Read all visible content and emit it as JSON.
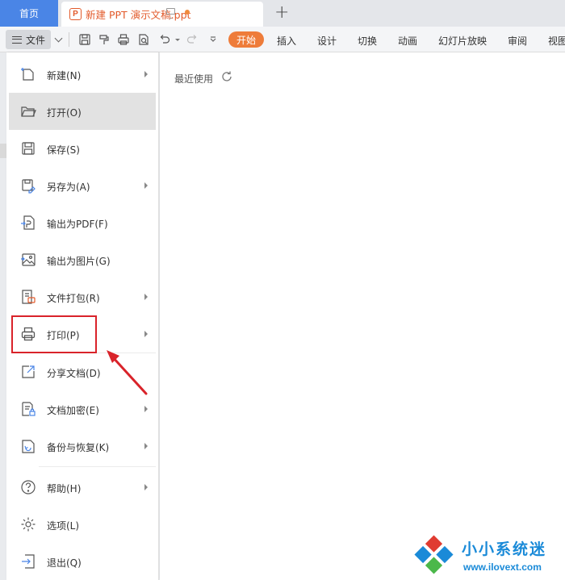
{
  "tabs": {
    "home": "首页",
    "document": "新建 PPT 演示文稿.ppt",
    "add": "+"
  },
  "toolbar": {
    "file_label": "文件",
    "start": "开始",
    "tabs": [
      "插入",
      "设计",
      "切换",
      "动画",
      "幻灯片放映",
      "审阅",
      "视图"
    ]
  },
  "menu": {
    "items": [
      {
        "label": "新建(N)",
        "icon": "new-document-icon",
        "submenu": true
      },
      {
        "label": "打开(O)",
        "icon": "folder-open-icon",
        "submenu": false,
        "active": true
      },
      {
        "label": "保存(S)",
        "icon": "save-icon",
        "submenu": false
      },
      {
        "label": "另存为(A)",
        "icon": "save-as-icon",
        "submenu": true
      },
      {
        "label": "输出为PDF(F)",
        "icon": "export-pdf-icon",
        "submenu": false
      },
      {
        "label": "输出为图片(G)",
        "icon": "export-image-icon",
        "submenu": false
      },
      {
        "label": "文件打包(R)",
        "icon": "package-icon",
        "submenu": true
      },
      {
        "label": "打印(P)",
        "icon": "printer-icon",
        "submenu": true
      },
      {
        "label": "分享文档(D)",
        "icon": "share-icon",
        "submenu": false
      },
      {
        "label": "文档加密(E)",
        "icon": "encrypt-document-icon",
        "submenu": true
      },
      {
        "label": "备份与恢复(K)",
        "icon": "backup-restore-icon",
        "submenu": true
      },
      {
        "label": "帮助(H)",
        "icon": "help-icon",
        "submenu": true
      },
      {
        "label": "选项(L)",
        "icon": "settings-gear-icon",
        "submenu": false
      },
      {
        "label": "退出(Q)",
        "icon": "exit-icon",
        "submenu": false
      }
    ]
  },
  "content": {
    "recent_label": "最近使用"
  },
  "watermark": {
    "title": "小小系统迷",
    "url": "www.ilovext.com"
  },
  "colors": {
    "tab_home_bg": "#4a85e6",
    "accent_orange": "#ee7c3a",
    "highlight_red": "#d9232a",
    "watermark_blue": "#1a8ad8"
  }
}
